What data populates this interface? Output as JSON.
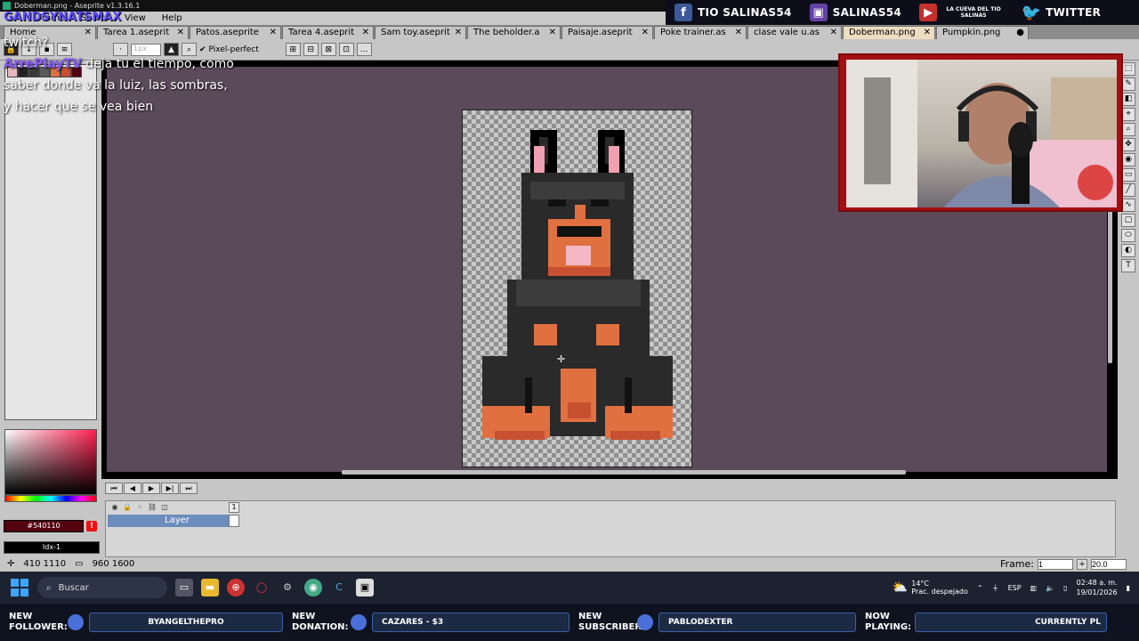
{
  "window": {
    "title": "Doberman.png - Aseprite v1.3.16.1"
  },
  "menubar": {
    "items": [
      "Frame",
      "Select",
      "View",
      "Help"
    ]
  },
  "tabs": [
    {
      "label": "Home",
      "active": false
    },
    {
      "label": "Tarea 1.aseprit",
      "active": false
    },
    {
      "label": "Patos.aseprite",
      "active": false
    },
    {
      "label": "Tarea 4.aseprit",
      "active": false
    },
    {
      "label": "Sam toy.aseprit",
      "active": false
    },
    {
      "label": "The beholder.a",
      "active": false
    },
    {
      "label": "Paisaje.aseprit",
      "active": false
    },
    {
      "label": "Poke trainer.as",
      "active": false
    },
    {
      "label": "clase vale u.as",
      "active": false
    },
    {
      "label": "Doberman.png",
      "active": true
    },
    {
      "label": "Pumpkin.png",
      "active": false
    }
  ],
  "toolbar": {
    "pixel_perfect_label": "Pixel-perfect",
    "brush_size_value": "1px"
  },
  "social": {
    "facebook": "TIO SALINAS54",
    "twitch": "SALINAS54",
    "youtube": "LA CUEVA DEL TIO SALINAS",
    "twitter": "TWITTER"
  },
  "chat": {
    "header": "GANDSYNATSMAX",
    "lines": [
      "twitch?"
    ],
    "user": "ArrePlayTV",
    "message": "deja tu el tiempo, como saber donde va la luiz, las sombras, y hacer que se vea bien"
  },
  "colors": {
    "canvas_bg": "#5b4a5a",
    "fg_color_hex": "#540110",
    "fg_color_label": "#540110",
    "bg_color_label": "Idx-1",
    "webcam_border": "#a30f12",
    "active_tab": "#ecdcc0"
  },
  "timeline": {
    "frame_number": "1",
    "layer_name": "Layer"
  },
  "status": {
    "cursor_pos": "410 1110",
    "canvas_size": "960 1600",
    "frame_label": "Frame:",
    "frame_value": "1",
    "zoom": "20.0"
  },
  "taskbar": {
    "search_placeholder": "Buscar",
    "weather_temp": "14°C",
    "weather_desc": "Prac. despejado",
    "lang": "ESP",
    "time": "02:48 a. m.",
    "date": "19/01/2026"
  },
  "alerts": {
    "follower_label": "NEW FOLLOWER:",
    "follower_value": "BYANGELTHEPRO",
    "donation_label": "NEW DONATION:",
    "donation_value": "CAZARES - $3",
    "subscriber_label": "NEW SUBSCRIBER:",
    "subscriber_value": "PABLODEXTER",
    "playing_label": "NOW PLAYING:",
    "playing_value": "CURRENTLY PL"
  },
  "icons": {
    "tray": [
      "weather-icon",
      "chevron-up-icon",
      "wifi-icon",
      "volume-icon",
      "notification-icon"
    ]
  }
}
